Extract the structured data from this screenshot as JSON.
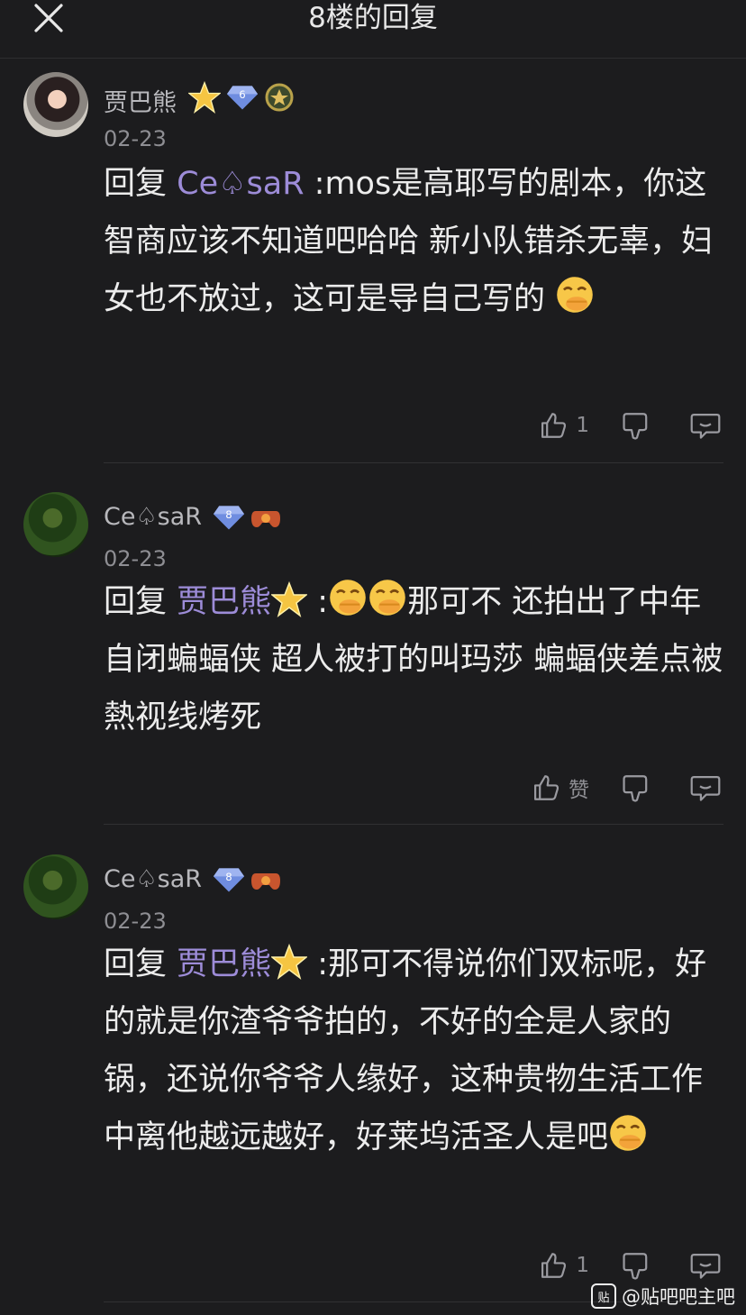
{
  "header": {
    "title": "8楼的回复",
    "close_icon": "close-icon"
  },
  "posts": [
    {
      "username": "贾巴熊",
      "badges": [
        {
          "icon": "star-icon"
        },
        {
          "icon": "level-diamond-icon",
          "level": "6"
        },
        {
          "icon": "medal-badge-icon"
        }
      ],
      "date": "02-23",
      "reply_prefix": "回复",
      "mention": "Ce♤saR",
      "text": ":mos是高耶写的剧本，你这智商应该不知道吧哈哈 新小队错杀无辜，妇女也不放过，这可是导自己写的",
      "trailing_emoji": "grin-covering-mouth-emoji",
      "likes": "1"
    },
    {
      "username": "Ce♤saR",
      "badges": [
        {
          "icon": "level-diamond-icon",
          "level": "8"
        },
        {
          "icon": "gamepad-badge-icon"
        }
      ],
      "date": "02-23",
      "reply_prefix": "回复",
      "mention": "贾巴熊",
      "mention_icon": "star-icon",
      "text_before_emoji": " :",
      "text": "那可不 还拍出了中年自闭蝙蝠侠 超人被打的叫玛莎 蝙蝠侠差点被熱视线烤死",
      "likes": "赞"
    },
    {
      "username": "Ce♤saR",
      "badges": [
        {
          "icon": "level-diamond-icon",
          "level": "8"
        },
        {
          "icon": "gamepad-badge-icon"
        }
      ],
      "date": "02-23",
      "reply_prefix": "回复",
      "mention": "贾巴熊",
      "mention_icon": "star-icon",
      "text": " :那可不得说你们双标呢，好的就是你渣爷爷拍的，不好的全是人家的锅，还说你爷爷人缘好，这种贵物生活工作中离他越远越好，好莱坞活圣人是吧",
      "trailing_emoji": "grin-covering-mouth-emoji",
      "likes": "1"
    }
  ],
  "watermark": {
    "icon_label": "贴",
    "text": "@贴吧吧主吧"
  },
  "colors": {
    "background": "#1c1c1e",
    "mention": "#9d8cd8",
    "text": "#ececec",
    "meta": "#8e8e93"
  }
}
